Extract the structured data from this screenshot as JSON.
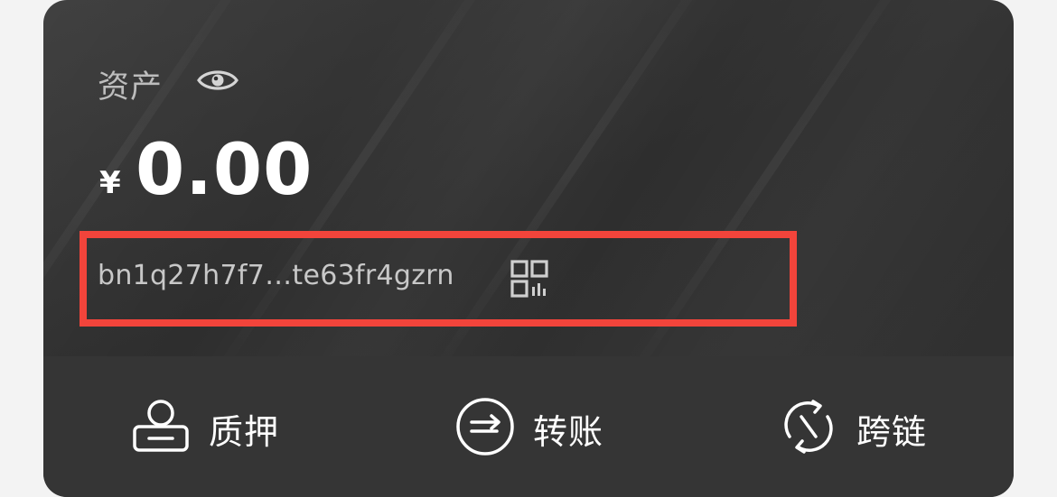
{
  "wallet": {
    "asset_label": "资产",
    "currency_symbol": "¥",
    "balance": "0.00",
    "address": "bn1q27h7f7…te63fr4gzrn",
    "icons": {
      "visibility": "eye-icon",
      "qrcode": "qrcode-icon"
    }
  },
  "actions": [
    {
      "label": "质押",
      "icon": "stake-icon"
    },
    {
      "label": "转账",
      "icon": "transfer-icon"
    },
    {
      "label": "跨链",
      "icon": "bridge-icon"
    }
  ],
  "colors": {
    "card_background": "#2f2f2f",
    "bottom_bar": "#353535",
    "highlight_border": "#f2443b",
    "text_primary": "#ffffff",
    "text_secondary": "#bdbdbd"
  }
}
